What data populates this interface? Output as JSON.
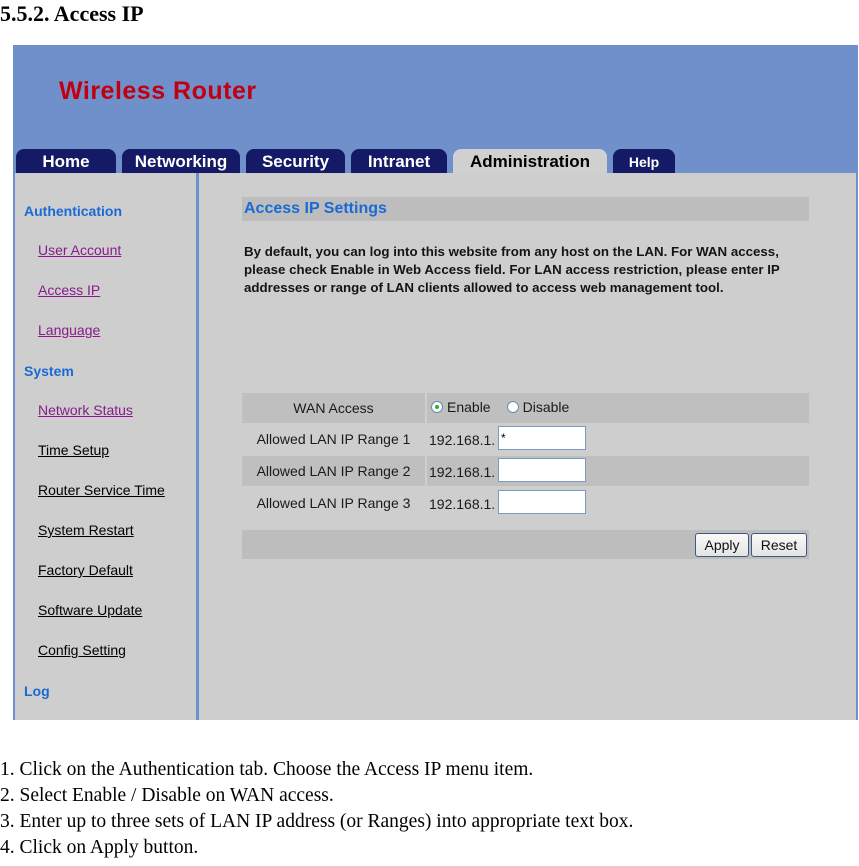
{
  "document": {
    "heading": "5.5.2. Access IP",
    "steps": [
      "1. Click on the Authentication tab. Choose the Access IP menu item.",
      "2. Select Enable / Disable on WAN access.",
      "3. Enter up to three sets of LAN IP address (or Ranges) into appropriate text box.",
      "4. Click on Apply button."
    ]
  },
  "router": {
    "brand": "Wireless Router",
    "colors": {
      "header_bg": "#7090cc",
      "brand_text": "#c00010",
      "tab_bg": "#141a66",
      "panel_bg": "#cecece",
      "accent_blue": "#1a6ad6",
      "visited_link": "#8a1a8a"
    },
    "tabs": [
      {
        "label": "Home",
        "active": false
      },
      {
        "label": "Networking",
        "active": false
      },
      {
        "label": "Security",
        "active": false
      },
      {
        "label": "Intranet",
        "active": false
      },
      {
        "label": "Administration",
        "active": true
      },
      {
        "label": "Help",
        "active": false
      }
    ],
    "sidebar": {
      "categories": [
        {
          "label": "Authentication",
          "items": [
            {
              "label": "User Account",
              "visited": true
            },
            {
              "label": "Access IP",
              "visited": true
            },
            {
              "label": "Language",
              "visited": true
            }
          ]
        },
        {
          "label": "System",
          "items": [
            {
              "label": "Network Status",
              "visited": true
            },
            {
              "label": "Time Setup",
              "visited": false
            },
            {
              "label": "Router Service Time",
              "visited": false
            },
            {
              "label": "System Restart",
              "visited": false
            },
            {
              "label": "Factory Default",
              "visited": false
            },
            {
              "label": "Software Update",
              "visited": false
            },
            {
              "label": "Config Setting",
              "visited": false
            }
          ]
        },
        {
          "label": "Log",
          "items": []
        }
      ]
    },
    "main": {
      "section_title": "Access IP Settings",
      "intro": "By default, you can log into this website from any host on the LAN. For WAN access, please check Enable in Web Access field. For LAN access restriction, please enter IP addresses or range of LAN clients allowed to access web management tool.",
      "wan_access": {
        "label": "WAN Access",
        "options": [
          "Enable",
          "Disable"
        ],
        "selected": "Enable"
      },
      "ranges": [
        {
          "label": "Allowed LAN IP Range 1",
          "prefix": "192.168.1.",
          "value": "*"
        },
        {
          "label": "Allowed LAN IP Range 2",
          "prefix": "192.168.1.",
          "value": ""
        },
        {
          "label": "Allowed LAN IP Range 3",
          "prefix": "192.168.1.",
          "value": ""
        }
      ],
      "buttons": {
        "apply": "Apply",
        "reset": "Reset"
      }
    }
  }
}
